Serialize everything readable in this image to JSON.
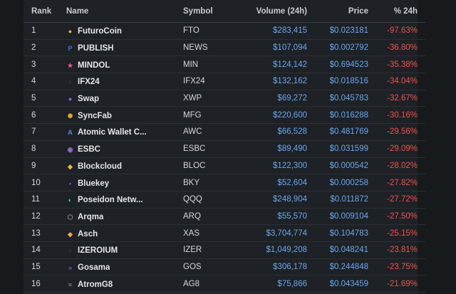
{
  "headers": {
    "rank": "Rank",
    "name": "Name",
    "symbol": "Symbol",
    "volume": "Volume (24h)",
    "price": "Price",
    "change": "% 24h"
  },
  "rows": [
    {
      "rank": "1",
      "name": "FuturoCoin",
      "symbol": "FTO",
      "volume": "$283,415",
      "price": "$0.023181",
      "change": "-97.63%"
    },
    {
      "rank": "2",
      "name": "PUBLISH",
      "symbol": "NEWS",
      "volume": "$107,094",
      "price": "$0.002792",
      "change": "-36.80%"
    },
    {
      "rank": "3",
      "name": "MINDOL",
      "symbol": "MIN",
      "volume": "$124,142",
      "price": "$0.694523",
      "change": "-35.38%"
    },
    {
      "rank": "4",
      "name": "IFX24",
      "symbol": "IFX24",
      "volume": "$132,162",
      "price": "$0.018516",
      "change": "-34.04%"
    },
    {
      "rank": "5",
      "name": "Swap",
      "symbol": "XWP",
      "volume": "$69,272",
      "price": "$0.045783",
      "change": "-32.67%"
    },
    {
      "rank": "6",
      "name": "SyncFab",
      "symbol": "MFG",
      "volume": "$220,600",
      "price": "$0.016288",
      "change": "-30.16%"
    },
    {
      "rank": "7",
      "name": "Atomic Wallet C...",
      "symbol": "AWC",
      "volume": "$66,528",
      "price": "$0.481769",
      "change": "-29.56%"
    },
    {
      "rank": "8",
      "name": "ESBC",
      "symbol": "ESBC",
      "volume": "$89,490",
      "price": "$0.031599",
      "change": "-29.09%"
    },
    {
      "rank": "9",
      "name": "Blockcloud",
      "symbol": "BLOC",
      "volume": "$122,300",
      "price": "$0.000542",
      "change": "-28.02%"
    },
    {
      "rank": "10",
      "name": "Bluekey",
      "symbol": "BKY",
      "volume": "$52,604",
      "price": "$0.000258",
      "change": "-27.82%"
    },
    {
      "rank": "11",
      "name": "Poseidon Netw...",
      "symbol": "QQQ",
      "volume": "$248,904",
      "price": "$0.011872",
      "change": "-27.72%"
    },
    {
      "rank": "12",
      "name": "Arqma",
      "symbol": "ARQ",
      "volume": "$55,570",
      "price": "$0.009104",
      "change": "-27.50%"
    },
    {
      "rank": "13",
      "name": "Asch",
      "symbol": "XAS",
      "volume": "$3,704,774",
      "price": "$0.104783",
      "change": "-25.15%"
    },
    {
      "rank": "14",
      "name": "IZEROIUM",
      "symbol": "IZER",
      "volume": "$1,049,208",
      "price": "$0.048241",
      "change": "-23.81%"
    },
    {
      "rank": "15",
      "name": "Gosama",
      "symbol": "GOS",
      "volume": "$306,178",
      "price": "$0.244848",
      "change": "-23.75%"
    },
    {
      "rank": "16",
      "name": "AtromG8",
      "symbol": "AG8",
      "volume": "$75,866",
      "price": "$0.043459",
      "change": "-21.69%"
    }
  ],
  "icons": [
    {
      "name": "futurocoin-icon",
      "color": "#f2a93b",
      "glyph": "●"
    },
    {
      "name": "publish-icon",
      "color": "#3f6fe0",
      "glyph": "P"
    },
    {
      "name": "mindol-icon",
      "color": "#e35d8a",
      "glyph": "★"
    },
    {
      "name": "ifx24-icon",
      "color": "#2a2d33",
      "glyph": "●"
    },
    {
      "name": "swap-icon",
      "color": "#7b6cf0",
      "glyph": "●"
    },
    {
      "name": "syncfab-icon",
      "color": "#e3a72f",
      "glyph": "✺"
    },
    {
      "name": "atomic-wallet-icon",
      "color": "#5a8cf2",
      "glyph": "A"
    },
    {
      "name": "esbc-icon",
      "color": "#9a6ae0",
      "glyph": "◉"
    },
    {
      "name": "blockcloud-icon",
      "color": "#f0b62c",
      "glyph": "◆"
    },
    {
      "name": "bluekey-icon",
      "color": "#3b6ff0",
      "glyph": "•"
    },
    {
      "name": "poseidon-icon",
      "color": "#58c9b9",
      "glyph": "◐"
    },
    {
      "name": "arqma-icon",
      "color": "#8a8f96",
      "glyph": "⬡"
    },
    {
      "name": "asch-icon",
      "color": "#f0a35a",
      "glyph": "◆"
    },
    {
      "name": "izeroium-icon",
      "color": "#2a2d33",
      "glyph": "●"
    },
    {
      "name": "gosama-icon",
      "color": "#6a5cf0",
      "glyph": "»"
    },
    {
      "name": "atromg8-icon",
      "color": "#8a8f96",
      "glyph": "≈"
    }
  ]
}
